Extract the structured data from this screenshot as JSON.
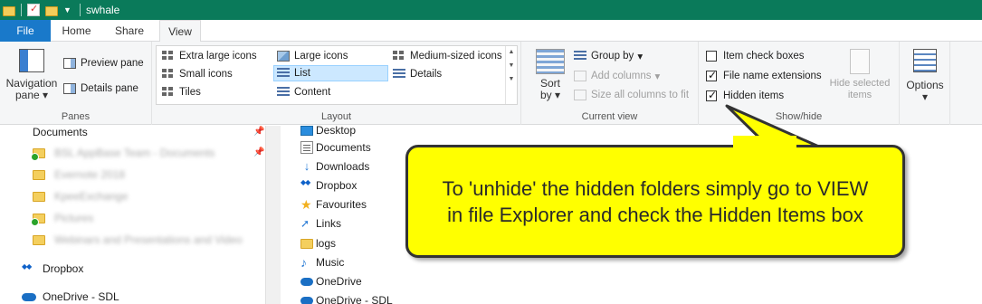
{
  "titlebar": {
    "title": "swhale"
  },
  "tabs": {
    "file": "File",
    "home": "Home",
    "share": "Share",
    "view": "View"
  },
  "panes": {
    "label": "Panes",
    "navigation_pane": "Navigation",
    "navigation_pane_2": "pane",
    "preview_pane": "Preview pane",
    "details_pane": "Details pane"
  },
  "layout": {
    "label": "Layout",
    "items": [
      "Extra large icons",
      "Large icons",
      "Medium-sized icons",
      "Small icons",
      "List",
      "Details",
      "Tiles",
      "Content"
    ],
    "selected": "List"
  },
  "current_view": {
    "label": "Current view",
    "sort_by": "Sort",
    "sort_by_2": "by",
    "group_by": "Group by",
    "add_columns": "Add columns",
    "size_all_columns": "Size all columns to fit"
  },
  "show_hide": {
    "label": "Show/hide",
    "item_check_boxes": "Item check boxes",
    "file_name_extensions": "File name extensions",
    "hidden_items": "Hidden items",
    "hide_selected": "Hide selected",
    "hide_selected_2": "items",
    "checks": {
      "item_check_boxes": false,
      "file_name_extensions": true,
      "hidden_items": true
    }
  },
  "options": {
    "label": "Options"
  },
  "nav": {
    "documents": "Documents",
    "blurred": [
      "BSL AppBase Team - Documents",
      "Evernote 2018",
      "KpeeExchange",
      "Pictures",
      "Webinars and Presentations and Video"
    ],
    "dropbox": "Dropbox",
    "onedrive_sdl": "OneDrive - SDL"
  },
  "content": {
    "items": [
      "Desktop",
      "Documents",
      "Downloads",
      "Dropbox",
      "Favourites",
      "Links",
      "logs",
      "Music",
      "OneDrive",
      "OneDrive - SDL"
    ]
  },
  "callout": {
    "text": "To 'unhide' the hidden folders simply go to VIEW in file Explorer and check the Hidden Items box"
  },
  "colors": {
    "titlebar": "#0a7a5a",
    "file_tab": "#1979ca",
    "callout": "#ffff00",
    "selection": "#cce8ff"
  }
}
